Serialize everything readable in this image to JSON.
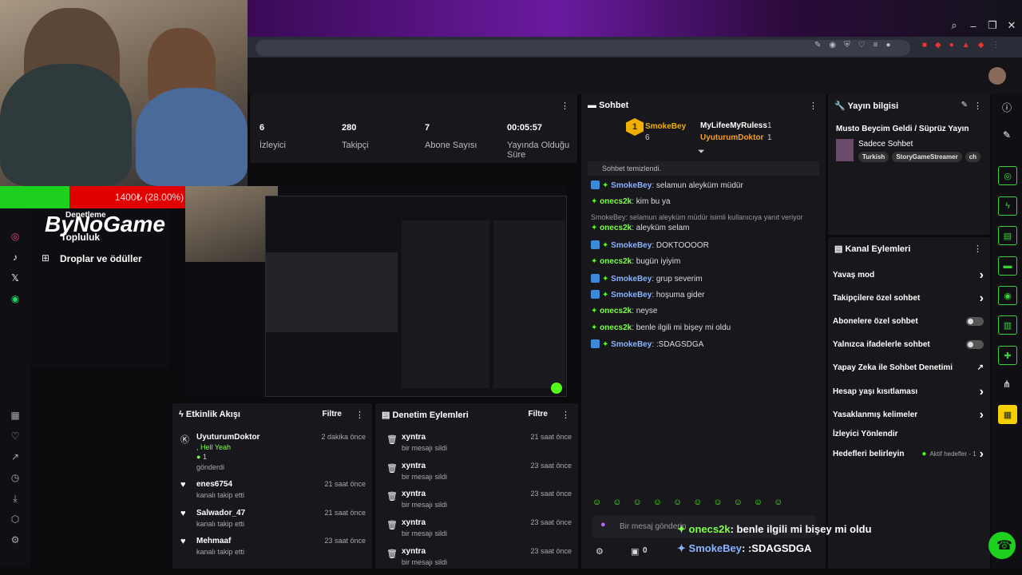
{
  "progress": {
    "text": "1400₺ (28.00%)",
    "percent": 28
  },
  "logo_text": "ByNoGame",
  "left_nav": {
    "items": [
      "Denetleme",
      "Topluluk",
      "Droplar ve ödüller"
    ]
  },
  "stats": [
    {
      "value": "6",
      "label": "İzleyici"
    },
    {
      "value": "280",
      "label": "Takipçi"
    },
    {
      "value": "7",
      "label": "Abone Sayısı"
    },
    {
      "value": "00:05:57",
      "label": "Yayında Olduğu Süre"
    }
  ],
  "chat": {
    "title": "Sohbet",
    "top": [
      {
        "name": "SmokeBey",
        "count": "6",
        "rank": "1"
      },
      {
        "name": "MyLifeeMyRuless",
        "count": "1"
      },
      {
        "name": "UyuturumDoktor",
        "count": "1"
      }
    ],
    "cleared": "Sohbet temizlendi.",
    "messages": [
      {
        "user": "SmokeBey",
        "text": ": selamun aleyküm müdür",
        "color": "blue"
      },
      {
        "user": "onecs2k",
        "text": ": kim bu ya",
        "color": "green"
      },
      {
        "user": "",
        "text": "SmokeBey: selamun aleyküm müdür isimli kullanıcıya yanıt veriyor",
        "color": "reply"
      },
      {
        "user": "onecs2k",
        "text": ": aleyküm selam",
        "color": "green"
      },
      {
        "user": "SmokeBey",
        "text": ": DOKTOOOOR",
        "color": "blue"
      },
      {
        "user": "onecs2k",
        "text": ": bugün iyiyim",
        "color": "green"
      },
      {
        "user": "SmokeBey",
        "text": ": grup severim",
        "color": "blue"
      },
      {
        "user": "SmokeBey",
        "text": ": hoşuma gider",
        "color": "blue"
      },
      {
        "user": "onecs2k",
        "text": ": neyse",
        "color": "green"
      },
      {
        "user": "onecs2k",
        "text": ": benle ilgili mi bişey mi oldu",
        "color": "green"
      },
      {
        "user": "SmokeBey",
        "text": ": :SDAGSDGA",
        "color": "blue"
      }
    ],
    "input_placeholder": "Bir mesaj gönderin",
    "footer_count": "0"
  },
  "stream_info": {
    "title": "Yayın bilgisi",
    "stream_title": "Musto Beycim Geldi / Süprüz Yayın",
    "category": "Sadece Sohbet",
    "tags": [
      "Turkish",
      "StoryGameStreamer",
      "ch"
    ]
  },
  "channel_actions": {
    "title": "Kanal Eylemleri",
    "items": [
      {
        "label": "Yavaş mod",
        "control": "arrow"
      },
      {
        "label": "Takipçilere özel sohbet",
        "control": "arrow"
      },
      {
        "label": "Abonelere özel sohbet",
        "control": "toggle"
      },
      {
        "label": "Yalnızca ifadelerle sohbet",
        "control": "toggle"
      },
      {
        "label": "Yapay Zeka ile Sohbet Denetimi",
        "control": "link"
      },
      {
        "label": "Hesap yaşı kısıtlaması",
        "control": "arrow"
      },
      {
        "label": "Yasaklanmış kelimeler",
        "control": "arrow"
      },
      {
        "label": "İzleyici Yönlendir",
        "control": "none"
      },
      {
        "label": "Hedefleri belirleyin",
        "control": "arrow",
        "extra": "Aktif hedefler - 1"
      }
    ]
  },
  "activity": {
    "title": "Etkinlik Akışı",
    "filter": "Filtre",
    "items": [
      {
        "name": "UyuturumDoktor",
        "sub": ", Hell Yeah",
        "extra": "1",
        "action": "gönderdi",
        "time": "2 dakika önce"
      },
      {
        "name": "enes6754",
        "action": "kanalı takip etti",
        "time": "21 saat önce"
      },
      {
        "name": "Salwador_47",
        "action": "kanalı takip etti",
        "time": "21 saat önce"
      },
      {
        "name": "Mehmaaf",
        "action": "kanalı takip etti",
        "time": "23 saat önce"
      }
    ]
  },
  "moderation": {
    "title": "Denetim Eylemleri",
    "filter": "Filtre",
    "items": [
      {
        "name": "xyntra",
        "action": "bir mesajı sildi",
        "time": "21 saat önce"
      },
      {
        "name": "xyntra",
        "action": "bir mesajı sildi",
        "time": "23 saat önce"
      },
      {
        "name": "xyntra",
        "action": "bir mesajı sildi",
        "time": "23 saat önce"
      },
      {
        "name": "xyntra",
        "action": "bir mesajı sildi",
        "time": "23 saat önce"
      },
      {
        "name": "xyntra",
        "action": "bir mesajı sildi",
        "time": "23 saat önce"
      }
    ]
  },
  "overlay_chat": [
    {
      "user": "onecs2k",
      "text": ": benle ilgili mi bişey mi oldu"
    },
    {
      "user": "SmokeBey",
      "text": ": :SDAGSDGA"
    }
  ],
  "colors": {
    "accent": "#53fc18",
    "bar_red": "#e00000",
    "bar_green": "#1ed01e",
    "user_blue": "#8ab4ff",
    "user_green": "#7fff4a"
  }
}
